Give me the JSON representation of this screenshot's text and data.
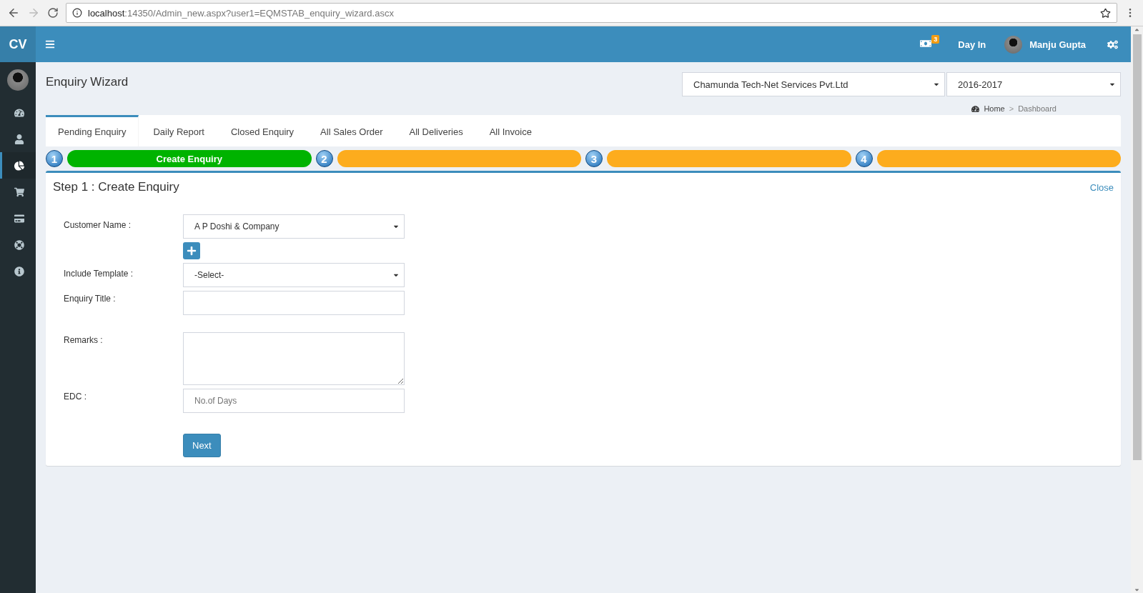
{
  "browser": {
    "url_host": "localhost",
    "url_rest": ":14350/Admin_new.aspx?user1=EQMSTAB_enquiry_wizard.ascx"
  },
  "header": {
    "logo": "CV",
    "notification_count": "3",
    "day_in": "Day In",
    "user_name": "Manju Gupta"
  },
  "sidebar": {
    "items": [
      {
        "selected": false
      },
      {
        "selected": false
      },
      {
        "selected": true
      },
      {
        "selected": false
      },
      {
        "selected": false
      },
      {
        "selected": false
      },
      {
        "selected": false
      }
    ]
  },
  "page": {
    "title": "Enquiry Wizard",
    "company": "Chamunda Tech-Net Services Pvt.Ltd",
    "year": "2016-2017",
    "breadcrumb": {
      "home": "Home",
      "separator": ">",
      "current": "Dashboard"
    }
  },
  "tabs": [
    {
      "label": "Pending Enquiry",
      "selected": true
    },
    {
      "label": "Daily Report",
      "selected": false
    },
    {
      "label": "Closed Enquiry",
      "selected": false
    },
    {
      "label": "All Sales Order",
      "selected": false
    },
    {
      "label": "All Deliveries",
      "selected": false
    },
    {
      "label": "All Invoice",
      "selected": false
    }
  ],
  "steps": [
    {
      "number": "1",
      "label": "Create Enquiry",
      "selected": true
    },
    {
      "number": "2",
      "selected": false
    },
    {
      "number": "3",
      "selected": false
    },
    {
      "number": "4",
      "selected": false
    }
  ],
  "panel": {
    "title": "Step 1 : Create Enquiry",
    "close": "Close",
    "fields": [
      {
        "kind": "select",
        "label": "Customer Name :",
        "value": "A P Doshi & Company",
        "add_button": true
      },
      {
        "kind": "select",
        "label": "Include Template :",
        "value": "-Select-"
      },
      {
        "kind": "input",
        "label": "Enquiry Title :"
      },
      {
        "kind": "textarea",
        "label": "Remarks :"
      },
      {
        "kind": "input",
        "label": "EDC :",
        "placeholder": "No.of Days"
      }
    ],
    "next": "Next"
  }
}
